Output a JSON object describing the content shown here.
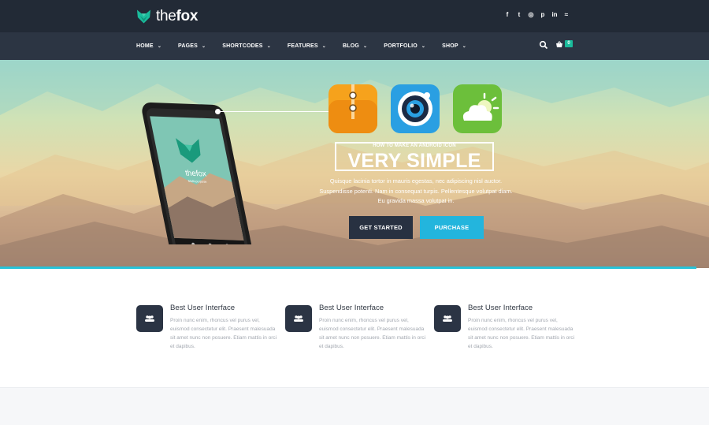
{
  "brand": {
    "name_light": "the",
    "name_bold": "fox"
  },
  "social": [
    {
      "icon": "facebook-icon",
      "glyph": "f"
    },
    {
      "icon": "twitter-icon",
      "glyph": "t"
    },
    {
      "icon": "dribbble-icon",
      "glyph": "◎"
    },
    {
      "icon": "pinterest-icon",
      "glyph": "p"
    },
    {
      "icon": "linkedin-icon",
      "glyph": "in"
    },
    {
      "icon": "rss-icon",
      "glyph": "≈"
    }
  ],
  "nav": {
    "items": [
      {
        "label": "HOME"
      },
      {
        "label": "PAGES"
      },
      {
        "label": "SHORTCODES"
      },
      {
        "label": "FEATURES"
      },
      {
        "label": "BLOG"
      },
      {
        "label": "PORTFOLIO"
      },
      {
        "label": "SHOP"
      }
    ],
    "cart_count": "0"
  },
  "hero": {
    "subheading": "HOW TO MAKE AN ANDROID ICON",
    "heading": "VERY SIMPLE",
    "description": "Quisque lacinia tortor in mauris egestas, nec adipiscing nisl auctor. Suspendisse potenti. Nam in consequat turpis. Pellentesque volutpat diam. Eu gravida massa volutpat in.",
    "btn_primary": "GET STARTED",
    "btn_secondary": "PURCHASE",
    "phone_brand": "thefox",
    "phone_tagline": "Multi-purpose"
  },
  "features": [
    {
      "title": "Best User Interface",
      "text": "Proin nunc enim, rhoncus vel purus vel, euismod consectetur elit. Praesent malesuada sit amet nunc non posuere. Etiam mattis in orci et dapibus."
    },
    {
      "title": "Best User Interface",
      "text": "Proin nunc enim, rhoncus vel purus vel, euismod consectetur elit. Praesent malesuada sit amet nunc non posuere. Etiam mattis in orci et dapibus."
    },
    {
      "title": "Best User Interface",
      "text": "Proin nunc enim, rhoncus vel purus vel, euismod consectetur elit. Praesent malesuada sit amet nunc non posuere. Etiam mattis in orci et dapibus."
    }
  ],
  "colors": {
    "topbar": "#222a36",
    "navbar": "#2c3543",
    "accent_teal": "#1abc9c",
    "accent_blue": "#23b5dd",
    "dark_button": "#283141"
  }
}
